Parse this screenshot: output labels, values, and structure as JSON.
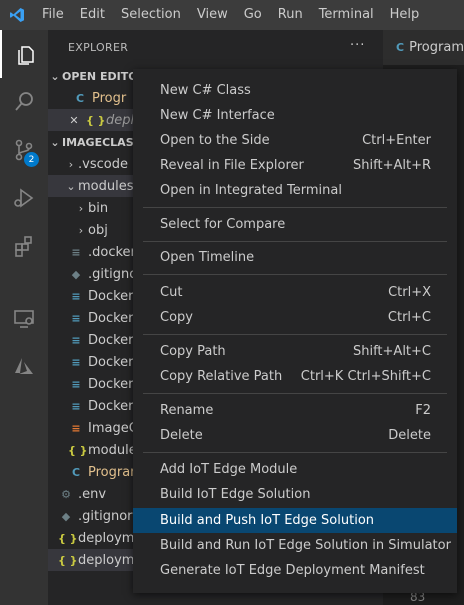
{
  "titlebar": {
    "menus": [
      "File",
      "Edit",
      "Selection",
      "View",
      "Go",
      "Run",
      "Terminal",
      "Help"
    ]
  },
  "activity_bar": {
    "scm_badge": "2"
  },
  "explorer": {
    "title": "EXPLORER",
    "more": "···",
    "open_editors": {
      "label": "OPEN EDITO",
      "items": [
        {
          "icon": "C",
          "name": "Progr"
        },
        {
          "close": "✕",
          "icon": "{ }",
          "name": "deplo"
        }
      ]
    },
    "project": {
      "label": "IMAGECLASS",
      "items": [
        {
          "twistie": "›",
          "name": ".vscode"
        },
        {
          "twistie": "⌄",
          "name": "modules"
        },
        {
          "twistie": "›",
          "name": "bin"
        },
        {
          "twistie": "›",
          "name": "obj"
        },
        {
          "icon": "≡",
          "name": ".docker"
        },
        {
          "icon": "◆",
          "name": ".gitignor"
        },
        {
          "icon": "≡",
          "name": "Dockerf"
        },
        {
          "icon": "≡",
          "name": "Dockerf"
        },
        {
          "icon": "≡",
          "name": "Dockerf"
        },
        {
          "icon": "≡",
          "name": "Dockerf"
        },
        {
          "icon": "≡",
          "name": "Dockerf"
        },
        {
          "icon": "≡",
          "name": "Dockerf"
        },
        {
          "icon": "≡",
          "name": "ImageC"
        },
        {
          "icon": "{ }",
          "name": "module"
        },
        {
          "icon": "C",
          "name": "Program"
        },
        {
          "icon": "⚙",
          "name": ".env"
        },
        {
          "icon": "◆",
          "name": ".gitignore"
        },
        {
          "icon": "{ }",
          "name": "deploym"
        },
        {
          "icon": "{ }",
          "name": "deploym"
        }
      ]
    }
  },
  "editor": {
    "tab": "Program",
    "line_number": "83"
  },
  "context_menu": {
    "items": [
      {
        "label": "New C# Class",
        "shortcut": ""
      },
      {
        "label": "New C# Interface",
        "shortcut": ""
      },
      {
        "label": "Open to the Side",
        "shortcut": "Ctrl+Enter"
      },
      {
        "label": "Reveal in File Explorer",
        "shortcut": "Shift+Alt+R"
      },
      {
        "label": "Open in Integrated Terminal",
        "shortcut": ""
      },
      {
        "label": "Select for Compare",
        "shortcut": ""
      },
      {
        "label": "Open Timeline",
        "shortcut": ""
      },
      {
        "label": "Cut",
        "shortcut": "Ctrl+X"
      },
      {
        "label": "Copy",
        "shortcut": "Ctrl+C"
      },
      {
        "label": "Copy Path",
        "shortcut": "Shift+Alt+C"
      },
      {
        "label": "Copy Relative Path",
        "shortcut": "Ctrl+K Ctrl+Shift+C"
      },
      {
        "label": "Rename",
        "shortcut": "F2"
      },
      {
        "label": "Delete",
        "shortcut": "Delete"
      },
      {
        "label": "Add IoT Edge Module",
        "shortcut": ""
      },
      {
        "label": "Build IoT Edge Solution",
        "shortcut": ""
      },
      {
        "label": "Build and Push IoT Edge Solution",
        "shortcut": "",
        "highlighted": true
      },
      {
        "label": "Build and Run IoT Edge Solution in Simulator",
        "shortcut": ""
      },
      {
        "label": "Generate IoT Edge Deployment Manifest",
        "shortcut": ""
      }
    ]
  },
  "colors": {
    "accent": "#007acc",
    "highlight": "#094771",
    "titlebar": "#3c3c3c",
    "activitybar": "#333333",
    "sidebar": "#252526"
  }
}
